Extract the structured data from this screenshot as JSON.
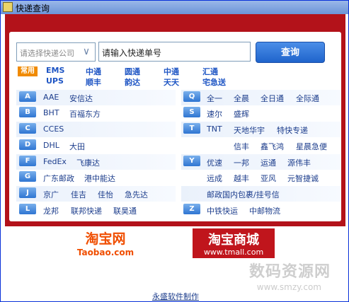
{
  "window": {
    "title": "快递查询"
  },
  "search": {
    "company_placeholder": "请选择快递公司",
    "tracking_placeholder": "请输入快递单号",
    "query_label": "查询"
  },
  "common": {
    "label": "常用",
    "rows": [
      [
        "EMS",
        "中通",
        "圆通",
        "中通",
        "汇通"
      ],
      [
        "UPS",
        "顺丰",
        "韵达",
        "天天",
        "宅急送"
      ]
    ]
  },
  "left_groups": [
    {
      "letter": "A",
      "items": [
        "AAE",
        "安信达"
      ]
    },
    {
      "letter": "B",
      "items": [
        "BHT",
        "百福东方"
      ]
    },
    {
      "letter": "C",
      "items": [
        "CCES"
      ]
    },
    {
      "letter": "D",
      "items": [
        "DHL",
        "大田"
      ]
    },
    {
      "letter": "F",
      "items": [
        "FedEx",
        "飞康达"
      ]
    },
    {
      "letter": "G",
      "items": [
        "广东邮政",
        "港中能达"
      ]
    },
    {
      "letter": "J",
      "items": [
        "京广",
        "佳吉",
        "佳怡",
        "急先达"
      ]
    },
    {
      "letter": "L",
      "items": [
        "龙邦",
        "联邦快递",
        "联昊通"
      ]
    }
  ],
  "right_groups": [
    {
      "letter": "Q",
      "items": [
        "全一",
        "全晨",
        "全日通",
        "全际通"
      ]
    },
    {
      "letter": "S",
      "items": [
        "速尔",
        "盛辉"
      ]
    },
    {
      "letter": "T",
      "items": [
        "TNT",
        "天地华宇",
        "特快专递"
      ]
    },
    {
      "letter": "",
      "items": [
        "信丰",
        "鑫飞鸿",
        "星晨急便"
      ]
    },
    {
      "letter": "Y",
      "items": [
        "优速",
        "一邦",
        "运通",
        "源伟丰"
      ]
    },
    {
      "letter": "",
      "items": [
        "远成",
        "越丰",
        "亚风",
        "元智捷诚"
      ]
    },
    {
      "letter": "",
      "items": [
        "邮政国内包裹/挂号信"
      ]
    },
    {
      "letter": "Z",
      "items": [
        "中铁快运",
        "中邮物流"
      ]
    }
  ],
  "logos": {
    "taobao_name": "淘宝网",
    "taobao_url": "Taobao.com",
    "tmall_name": "淘宝商城",
    "tmall_url": "www.tmall.com"
  },
  "footer": {
    "credit": "永盛软件制作"
  },
  "watermark": {
    "text": "数码资源网",
    "url": "www.smzy.com"
  }
}
